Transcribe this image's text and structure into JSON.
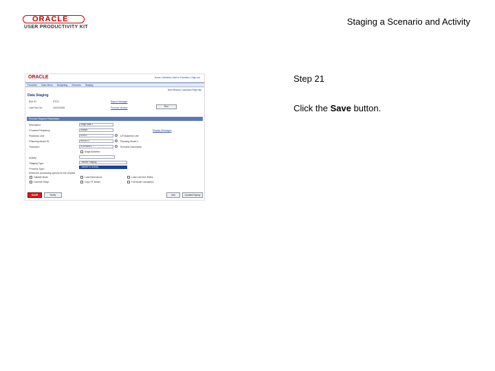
{
  "slide": {
    "title": "Staging a Scenario and Activity",
    "logo": {
      "brand": "ORACLE",
      "product": "USER PRODUCTIVITY KIT"
    }
  },
  "step": {
    "label": "Step 21",
    "instruction_pre": "Click the ",
    "instruction_target": "Save",
    "instruction_post": " button."
  },
  "screenshot": {
    "brand": "ORACLE",
    "header_links": "Home | Worklist | Add to Favorites | Sign out",
    "menu": [
      "Favorites",
      "Main Menu",
      "Budgeting",
      "Scenario",
      "Staging"
    ],
    "utility_links": "New Window  Customize Page  http",
    "page_title": "Data Staging",
    "run_id_label": "Run ID:",
    "run_id_value": "STG1",
    "last_run_label": "Last Run On:",
    "last_run_value": "10/01/2008",
    "links": {
      "report_manager": "Report Manager",
      "process_monitor": "Process Monitor"
    },
    "run_button": "Run",
    "section_title": "Process Request Parameters",
    "fields": [
      {
        "label": "Description:",
        "value": "Stage data 1"
      },
      {
        "label": "*Process Frequency:",
        "value": "Always"
      },
      {
        "label": "*Business Unit:",
        "value": "US001"
      },
      {
        "label": "*Planning Model ID:",
        "value": "MODEL1"
      },
      {
        "label": "*Scenario:",
        "value": "SCENARIO"
      }
    ],
    "field_notes": [
      "Display Messages",
      "US Business Unit",
      "Planning Model 1",
      "Scenario Description"
    ],
    "checkbox_all": "Stage Activities",
    "activity_label": "Activity:",
    "staging_type_label": "*Staging Type:",
    "staging_type_value": "Transfer Staging",
    "process_type_label": "*Process Type:",
    "process_type_value": "Transfer to Activity",
    "options_note": "Select the processing options for the request:",
    "options": [
      "Validate Mode",
      "Load Dimensions",
      "Load Line Item Rates",
      "Override Setup",
      "Copy PF Model",
      "Full Model Calculation"
    ],
    "buttons": {
      "save": "SAVE",
      "notify": "Notify",
      "add": "Add",
      "update": "Update/Display"
    }
  }
}
